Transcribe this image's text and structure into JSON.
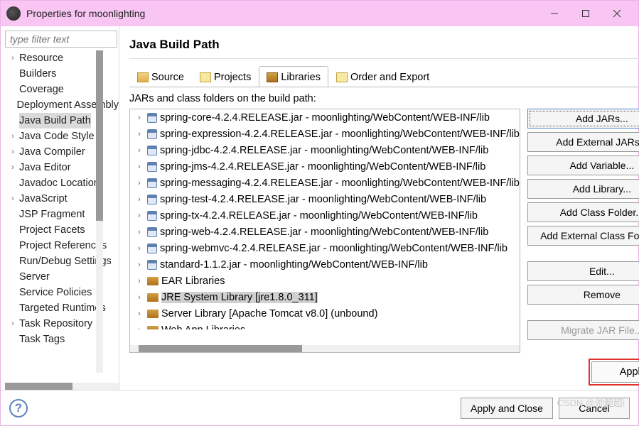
{
  "window": {
    "title": "Properties for moonlighting"
  },
  "filter": {
    "placeholder": "type filter text"
  },
  "tree": {
    "items": [
      {
        "label": "Resource",
        "expandable": true
      },
      {
        "label": "Builders",
        "expandable": false
      },
      {
        "label": "Coverage",
        "expandable": false
      },
      {
        "label": "Deployment Assembly",
        "expandable": false
      },
      {
        "label": "Java Build Path",
        "expandable": false,
        "selected": true
      },
      {
        "label": "Java Code Style",
        "expandable": true
      },
      {
        "label": "Java Compiler",
        "expandable": true
      },
      {
        "label": "Java Editor",
        "expandable": true
      },
      {
        "label": "Javadoc Location",
        "expandable": false
      },
      {
        "label": "JavaScript",
        "expandable": true
      },
      {
        "label": "JSP Fragment",
        "expandable": false
      },
      {
        "label": "Project Facets",
        "expandable": false
      },
      {
        "label": "Project References",
        "expandable": false
      },
      {
        "label": "Run/Debug Settings",
        "expandable": false
      },
      {
        "label": "Server",
        "expandable": false
      },
      {
        "label": "Service Policies",
        "expandable": false
      },
      {
        "label": "Targeted Runtimes",
        "expandable": false
      },
      {
        "label": "Task Repository",
        "expandable": true
      },
      {
        "label": "Task Tags",
        "expandable": false
      }
    ]
  },
  "page": {
    "title": "Java Build Path"
  },
  "tabs": {
    "source": "Source",
    "projects": "Projects",
    "libraries": "Libraries",
    "order": "Order and Export"
  },
  "libs": {
    "desc": "JARs and class folders on the build path:",
    "items": [
      {
        "icon": "jar",
        "label": "spring-core-4.2.4.RELEASE.jar - moonlighting/WebContent/WEB-INF/lib"
      },
      {
        "icon": "jar",
        "label": "spring-expression-4.2.4.RELEASE.jar - moonlighting/WebContent/WEB-INF/lib"
      },
      {
        "icon": "jar",
        "label": "spring-jdbc-4.2.4.RELEASE.jar - moonlighting/WebContent/WEB-INF/lib"
      },
      {
        "icon": "jar",
        "label": "spring-jms-4.2.4.RELEASE.jar - moonlighting/WebContent/WEB-INF/lib"
      },
      {
        "icon": "jar",
        "label": "spring-messaging-4.2.4.RELEASE.jar - moonlighting/WebContent/WEB-INF/lib"
      },
      {
        "icon": "jar",
        "label": "spring-test-4.2.4.RELEASE.jar - moonlighting/WebContent/WEB-INF/lib"
      },
      {
        "icon": "jar",
        "label": "spring-tx-4.2.4.RELEASE.jar - moonlighting/WebContent/WEB-INF/lib"
      },
      {
        "icon": "jar",
        "label": "spring-web-4.2.4.RELEASE.jar - moonlighting/WebContent/WEB-INF/lib"
      },
      {
        "icon": "jar",
        "label": "spring-webmvc-4.2.4.RELEASE.jar - moonlighting/WebContent/WEB-INF/lib"
      },
      {
        "icon": "jar",
        "label": "standard-1.1.2.jar - moonlighting/WebContent/WEB-INF/lib"
      },
      {
        "icon": "libfolder",
        "label": "EAR Libraries"
      },
      {
        "icon": "libfolder",
        "label": "JRE System Library [jre1.8.0_311]",
        "selected": true
      },
      {
        "icon": "libfolder",
        "label": "Server Library [Apache Tomcat v8.0] (unbound)"
      },
      {
        "icon": "libfolder",
        "label": "Web App Libraries"
      }
    ]
  },
  "buttons": {
    "add_jars": "Add JARs...",
    "add_ext_jars": "Add External JARs...",
    "add_var": "Add Variable...",
    "add_lib": "Add Library...",
    "add_class": "Add Class Folder...",
    "add_ext_class": "Add External Class Folder...",
    "edit": "Edit...",
    "remove": "Remove",
    "migrate": "Migrate JAR File...",
    "apply": "Apply",
    "apply_close": "Apply and Close",
    "cancel": "Cancel"
  },
  "watermark": "CSDN @帅超超i"
}
